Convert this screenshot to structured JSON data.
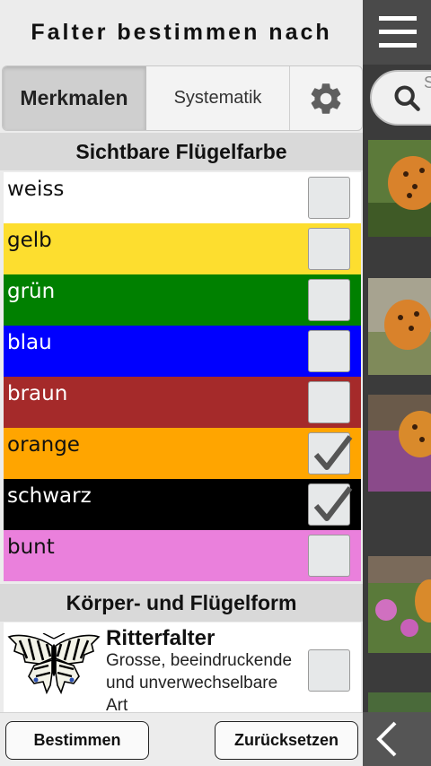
{
  "drawer": {
    "title": "Falter bestimmen nach",
    "tabs": [
      {
        "label": "Merkmalen",
        "active": true
      },
      {
        "label": "Systematik",
        "active": false
      }
    ],
    "settings_icon": "gear-icon"
  },
  "flugelfarbe": {
    "header": "Sichtbare Flügelfarbe",
    "items": [
      {
        "label": "weiss",
        "bg": "#ffffff",
        "fg": "#111111",
        "checked": false
      },
      {
        "label": "gelb",
        "bg": "#fdde2f",
        "fg": "#111111",
        "checked": false
      },
      {
        "label": "grün",
        "bg": "#008000",
        "fg": "#ffffff",
        "checked": false
      },
      {
        "label": "blau",
        "bg": "#0000ff",
        "fg": "#ffffff",
        "checked": false
      },
      {
        "label": "braun",
        "bg": "#a52a2a",
        "fg": "#ffffff",
        "checked": false
      },
      {
        "label": "orange",
        "bg": "#ffa500",
        "fg": "#111111",
        "checked": true
      },
      {
        "label": "schwarz",
        "bg": "#000000",
        "fg": "#ffffff",
        "checked": true
      },
      {
        "label": "bunt",
        "bg": "#ea80dc",
        "fg": "#111111",
        "checked": false
      }
    ]
  },
  "form": {
    "header": "Körper- und Flügelform",
    "species": {
      "name": "Ritterfalter",
      "description": "Grosse, beeindruckende\nund unverwechselbare\nArt",
      "checked": false,
      "icon": "swallowtail-butterfly-icon"
    }
  },
  "buttons": {
    "bestimmen": "Bestimmen",
    "zuruecksetzen": "Zurücksetzen"
  },
  "right_panel": {
    "menu_icon": "hamburger-menu-icon",
    "search_icon": "search-icon",
    "search_partial_text": "S",
    "back_icon": "chevron-left-icon"
  },
  "colors": {
    "drawer_bg": "#ececec",
    "section_header_bg": "#d9d9d9",
    "right_panel_bg": "#3b3b3b"
  }
}
